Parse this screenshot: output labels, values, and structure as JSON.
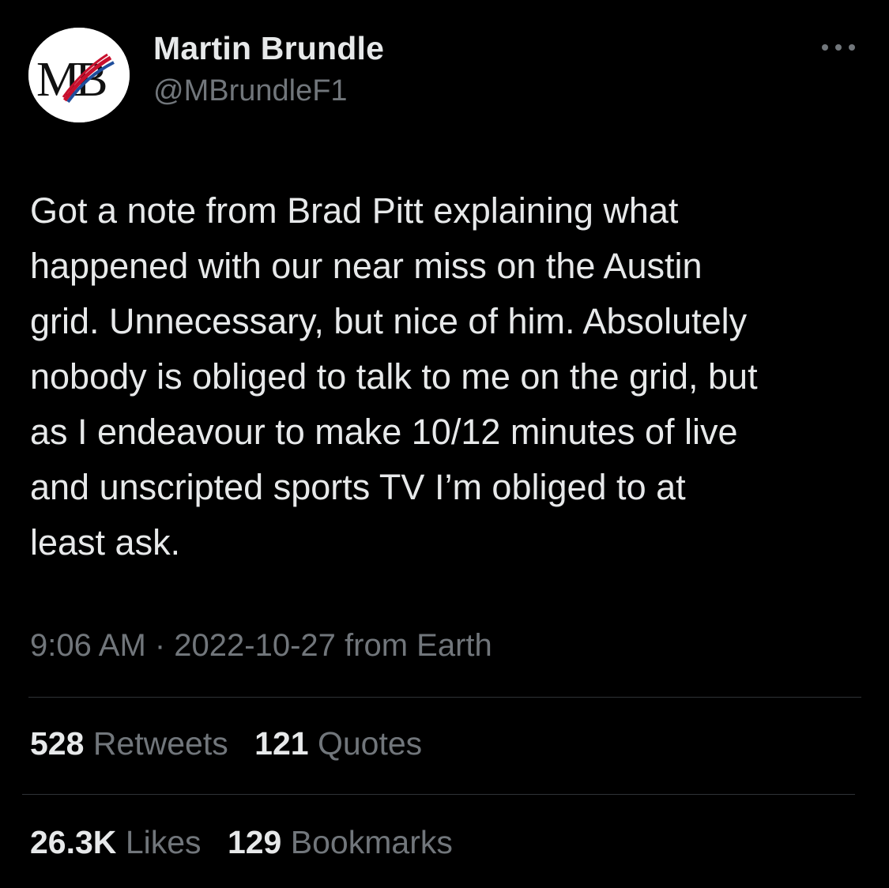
{
  "author": {
    "name": "Martin Brundle",
    "handle": "@MBrundleF1",
    "avatar_text": "MB"
  },
  "tweet": {
    "text": "Got a note from Brad Pitt explaining what\nhappened with our near miss on the Austin\ngrid. Unnecessary, but nice of him. Absolutely\nnobody is obliged to talk to me on the grid, but\nas I endeavour to make 10/12 minutes of live\nand unscripted sports TV I’m obliged to at\nleast ask.",
    "meta": "9:06 AM · 2022-10-27 from Earth"
  },
  "stats": {
    "retweets_count": "528",
    "retweets_label": "Retweets",
    "quotes_count": "121",
    "quotes_label": "Quotes",
    "likes_count": "26.3K",
    "likes_label": "Likes",
    "bookmarks_count": "129",
    "bookmarks_label": "Bookmarks"
  },
  "icons": {
    "more": "more-horizontal-icon"
  },
  "colors": {
    "background": "#000000",
    "primary_text": "#e7e9ea",
    "secondary_text": "#71767b",
    "divider": "#2f3336",
    "logo_red": "#c8102e",
    "logo_blue": "#1f4e9c"
  }
}
